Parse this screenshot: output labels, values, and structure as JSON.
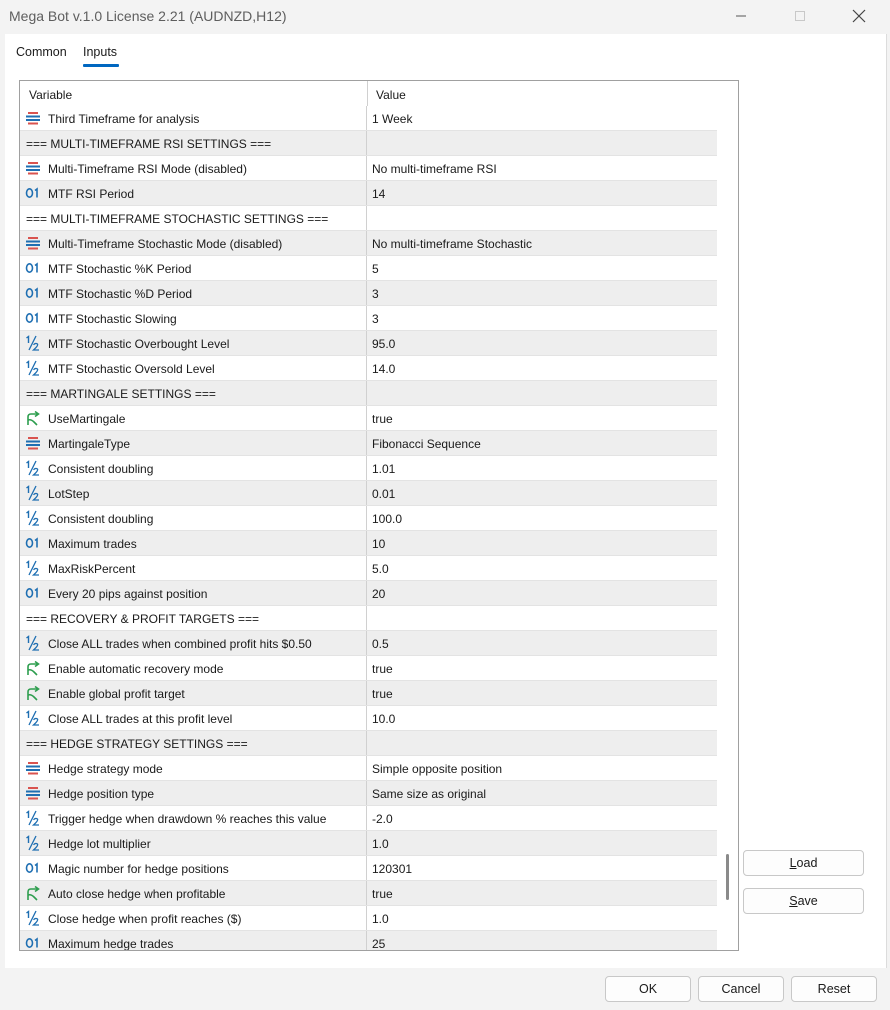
{
  "window": {
    "title": "Mega Bot v.1.0 License 2.21 (AUDNZD,H12)"
  },
  "tabs": [
    {
      "label": "Common",
      "active": false
    },
    {
      "label": "Inputs",
      "active": true
    }
  ],
  "grid": {
    "headers": {
      "variable": "Variable",
      "value": "Value"
    },
    "rows": [
      {
        "type": "enum",
        "icon": "enum-icon",
        "variable": "Third Timeframe for analysis",
        "value": "1 Week"
      },
      {
        "type": "section",
        "variable": "=== MULTI-TIMEFRAME RSI SETTINGS ===",
        "value": ""
      },
      {
        "type": "enum",
        "icon": "enum-icon",
        "variable": "Multi-Timeframe RSI Mode (disabled)",
        "value": "No multi-timeframe RSI"
      },
      {
        "type": "int",
        "icon": "integer-icon",
        "variable": "MTF RSI Period",
        "value": "14"
      },
      {
        "type": "section",
        "variable": "=== MULTI-TIMEFRAME STOCHASTIC SETTINGS ===",
        "value": ""
      },
      {
        "type": "enum",
        "icon": "enum-icon",
        "variable": "Multi-Timeframe Stochastic Mode (disabled)",
        "value": "No multi-timeframe Stochastic"
      },
      {
        "type": "int",
        "icon": "integer-icon",
        "variable": "MTF Stochastic %K Period",
        "value": "5"
      },
      {
        "type": "int",
        "icon": "integer-icon",
        "variable": "MTF Stochastic %D Period",
        "value": "3"
      },
      {
        "type": "int",
        "icon": "integer-icon",
        "variable": "MTF Stochastic Slowing",
        "value": "3"
      },
      {
        "type": "double",
        "icon": "half-fraction-icon",
        "variable": "MTF Stochastic Overbought Level",
        "value": "95.0"
      },
      {
        "type": "double",
        "icon": "half-fraction-icon",
        "variable": "MTF Stochastic Oversold Level",
        "value": "14.0"
      },
      {
        "type": "section",
        "variable": "=== MARTINGALE SETTINGS ===",
        "value": ""
      },
      {
        "type": "bool",
        "icon": "boolean-arrow-icon",
        "variable": "UseMartingale",
        "value": "true"
      },
      {
        "type": "enum",
        "icon": "enum-icon",
        "variable": "MartingaleType",
        "value": "Fibonacci Sequence"
      },
      {
        "type": "double",
        "icon": "half-fraction-icon",
        "variable": "Consistent doubling",
        "value": "1.01"
      },
      {
        "type": "double",
        "icon": "half-fraction-icon",
        "variable": "LotStep",
        "value": "0.01"
      },
      {
        "type": "double",
        "icon": "half-fraction-icon",
        "variable": "Consistent doubling",
        "value": "100.0"
      },
      {
        "type": "int",
        "icon": "integer-icon",
        "variable": "Maximum trades",
        "value": "10"
      },
      {
        "type": "double",
        "icon": "half-fraction-icon",
        "variable": "MaxRiskPercent",
        "value": "5.0"
      },
      {
        "type": "int",
        "icon": "integer-icon",
        "variable": "Every 20 pips against position",
        "value": "20"
      },
      {
        "type": "section",
        "variable": "=== RECOVERY & PROFIT TARGETS ===",
        "value": ""
      },
      {
        "type": "double",
        "icon": "half-fraction-icon",
        "variable": "Close ALL trades when combined profit hits $0.50",
        "value": "0.5"
      },
      {
        "type": "bool",
        "icon": "boolean-arrow-icon",
        "variable": "Enable automatic recovery mode",
        "value": "true"
      },
      {
        "type": "bool",
        "icon": "boolean-arrow-icon",
        "variable": "Enable global profit target",
        "value": "true"
      },
      {
        "type": "double",
        "icon": "half-fraction-icon",
        "variable": "Close ALL trades at this profit level",
        "value": "10.0"
      },
      {
        "type": "section",
        "variable": "=== HEDGE STRATEGY SETTINGS ===",
        "value": ""
      },
      {
        "type": "enum",
        "icon": "enum-icon",
        "variable": "Hedge strategy mode",
        "value": "Simple opposite position"
      },
      {
        "type": "enum",
        "icon": "enum-icon",
        "variable": "Hedge position type",
        "value": "Same size as original"
      },
      {
        "type": "double",
        "icon": "half-fraction-icon",
        "variable": "Trigger hedge when drawdown % reaches this value",
        "value": "-2.0"
      },
      {
        "type": "double",
        "icon": "half-fraction-icon",
        "variable": "Hedge lot multiplier",
        "value": "1.0"
      },
      {
        "type": "int",
        "icon": "integer-icon",
        "variable": "Magic number for hedge positions",
        "value": "120301"
      },
      {
        "type": "bool",
        "icon": "boolean-arrow-icon",
        "variable": "Auto close hedge when profitable",
        "value": "true"
      },
      {
        "type": "double",
        "icon": "half-fraction-icon",
        "variable": "Close hedge when profit reaches ($)",
        "value": "1.0"
      },
      {
        "type": "int",
        "icon": "integer-icon",
        "variable": "Maximum hedge trades",
        "value": "25"
      }
    ]
  },
  "buttons": {
    "load": {
      "first": "L",
      "rest": "oad"
    },
    "save": {
      "first": "S",
      "rest": "ave"
    },
    "ok": "OK",
    "cancel": "Cancel",
    "reset": "Reset"
  },
  "colors": {
    "accent": "#0067c0",
    "enum_icon_red": "#d9534f",
    "enum_icon_blue": "#1f6fb2",
    "bool_icon_green": "#2e9e4f",
    "int_icon_blue": "#1f6fb2"
  }
}
